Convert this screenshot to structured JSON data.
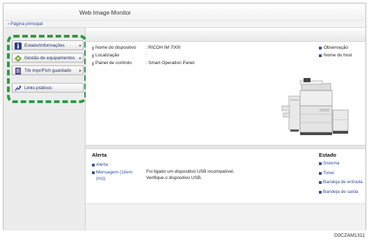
{
  "header": {
    "title": "Web Image Monitor"
  },
  "nav": {
    "home_link": "Página principal"
  },
  "sidebar": {
    "items": [
      {
        "label": "Estado/Informações",
        "icon": "info-icon"
      },
      {
        "label": "Gestão de equipamentos",
        "icon": "device-management-icon"
      },
      {
        "label": "Trb impr/Fich guardado",
        "icon": "stored-document-icon"
      },
      {
        "label": "Links práticos",
        "icon": "link-arrow-icon"
      }
    ]
  },
  "device_info": {
    "rows": [
      {
        "key": "Nome do dispositivo",
        "value": "RICOH IM 7000"
      },
      {
        "key": "Localização",
        "value": ""
      },
      {
        "key": "Painel de controlo",
        "value": "Smart Operation Panel"
      }
    ],
    "right_links": [
      "Observação",
      "Nome do host"
    ]
  },
  "alert": {
    "title": "Alerta",
    "links": [
      "Alerta",
      "Mensagem (1item",
      "(ns))"
    ],
    "message_line1": "Foi ligado um dispositivo USB incompatível.",
    "message_line2": "Verifique o dispositivo USB."
  },
  "status": {
    "title": "Estado",
    "links": [
      "Sistema",
      "Toner",
      "Bandeja de entrada",
      "Bandeja de saída"
    ]
  },
  "figure_code": "D0CZAM1311",
  "colors": {
    "highlight_dashed": "#2e9a45",
    "link": "#2a4d9c",
    "bullet": "#3b4f9a"
  }
}
